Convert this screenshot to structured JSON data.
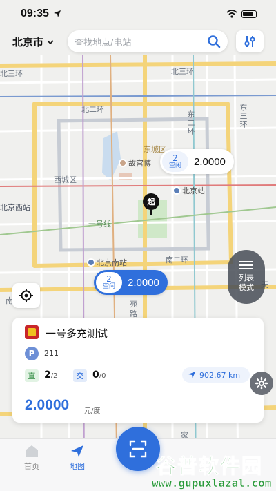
{
  "status_bar": {
    "time": "09:35"
  },
  "header": {
    "city": "北京市",
    "search_placeholder": "查找地点/电站"
  },
  "map": {
    "labels": {
      "north3": "北三环",
      "north3b": "北三环",
      "north2": "北二环",
      "east2": "东二环",
      "east3": "东三环",
      "dongcheng": "东城区",
      "xicheng": "西城区",
      "palace": "故宫博",
      "beijing_station": "北京站",
      "beijing_west": "北京西站",
      "beijing_south": "北京南站",
      "south2": "南二环",
      "line1": "一号线",
      "tianjin": "天",
      "yuan": "苑",
      "lu": "路",
      "nan": "南",
      "jia": "家",
      "east3_right": "东三环"
    }
  },
  "bubbles": [
    {
      "count": "2",
      "status": "空闲",
      "price": "2.0000",
      "style": "white"
    },
    {
      "count": "2",
      "status": "空闲",
      "price": "2.0000",
      "style": "blue"
    }
  ],
  "start_pin": "起",
  "list_mode": {
    "label": "列表模式"
  },
  "station_card": {
    "name": "一号多充测试",
    "parking_badge": "P",
    "parking_value": "211",
    "dc_tag": "直",
    "dc_available": "2",
    "dc_total": "/2",
    "ac_tag": "交",
    "ac_available": "0",
    "ac_total": "/0",
    "distance": "902.67 km",
    "price": "2.0000",
    "unit": "元/度"
  },
  "nav": {
    "home": "首页",
    "map": "地图"
  },
  "watermark": {
    "big": "谷普软件园",
    "small": "www.gupuxlazal.com"
  },
  "colors": {
    "primary": "#2f6fdc",
    "card_bg": "#ffffff",
    "map_bg": "#f1f1ef"
  },
  "icons": [
    "navigation-arrow-icon",
    "wifi-icon",
    "battery-icon",
    "chevron-down-icon",
    "search-icon",
    "filter-icon",
    "locate-icon",
    "list-icon",
    "brand-logo-icon",
    "navigate-icon",
    "gear-icon",
    "home-icon",
    "map-icon",
    "scan-icon"
  ]
}
